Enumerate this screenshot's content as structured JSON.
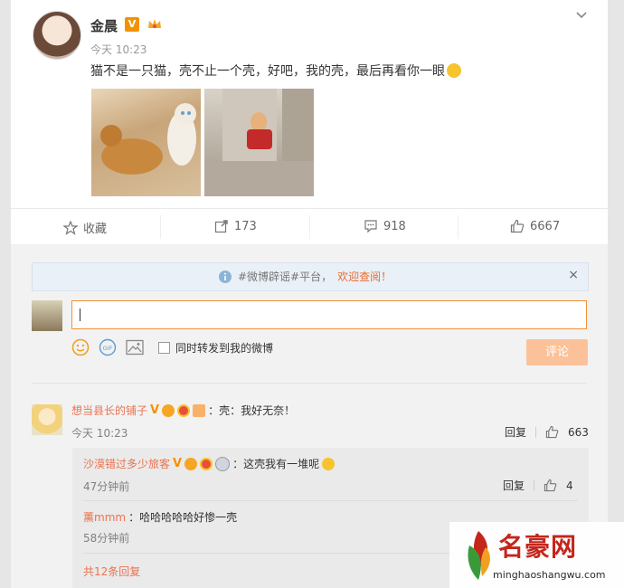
{
  "post": {
    "author": "金晨",
    "verified_badge": "V",
    "time": "今天 10:23",
    "text": "猫不是一只猫，壳不止一个壳，好吧，我的壳，最后再看你一眼",
    "emoji": "laugh-cry-emoji"
  },
  "actions": {
    "collect_label": "收藏",
    "repost_count": "173",
    "comment_count": "918",
    "like_count": "6667"
  },
  "notice": {
    "prefix": "#微博辟谣#平台，",
    "link": "欢迎查阅！",
    "close": "×"
  },
  "composer": {
    "input_value": "",
    "forward_label": "同时转发到我的微博",
    "submit_label": "评论"
  },
  "comments": [
    {
      "user": "想当县长的铺子",
      "text": "：壳：我好无奈！",
      "time": "今天 10:23",
      "reply_label": "回复",
      "likes": "663",
      "replies": [
        {
          "user": "沙漠错过多少旅客",
          "text": "：这壳我有一堆呢",
          "time": "47分钟前",
          "reply_label": "回复",
          "likes": "4"
        },
        {
          "user": "薰mmm",
          "text": "：哈哈哈哈哈好惨一壳",
          "time": "58分钟前"
        }
      ],
      "more_replies": "共12条回复"
    }
  ],
  "watermark": {
    "title": "名豪网",
    "url": "minghaoshangwu.com"
  },
  "colors": {
    "accent": "#eb7350",
    "link": "#e86b2f",
    "vip": "#f39200",
    "button": "#fbc29a"
  }
}
